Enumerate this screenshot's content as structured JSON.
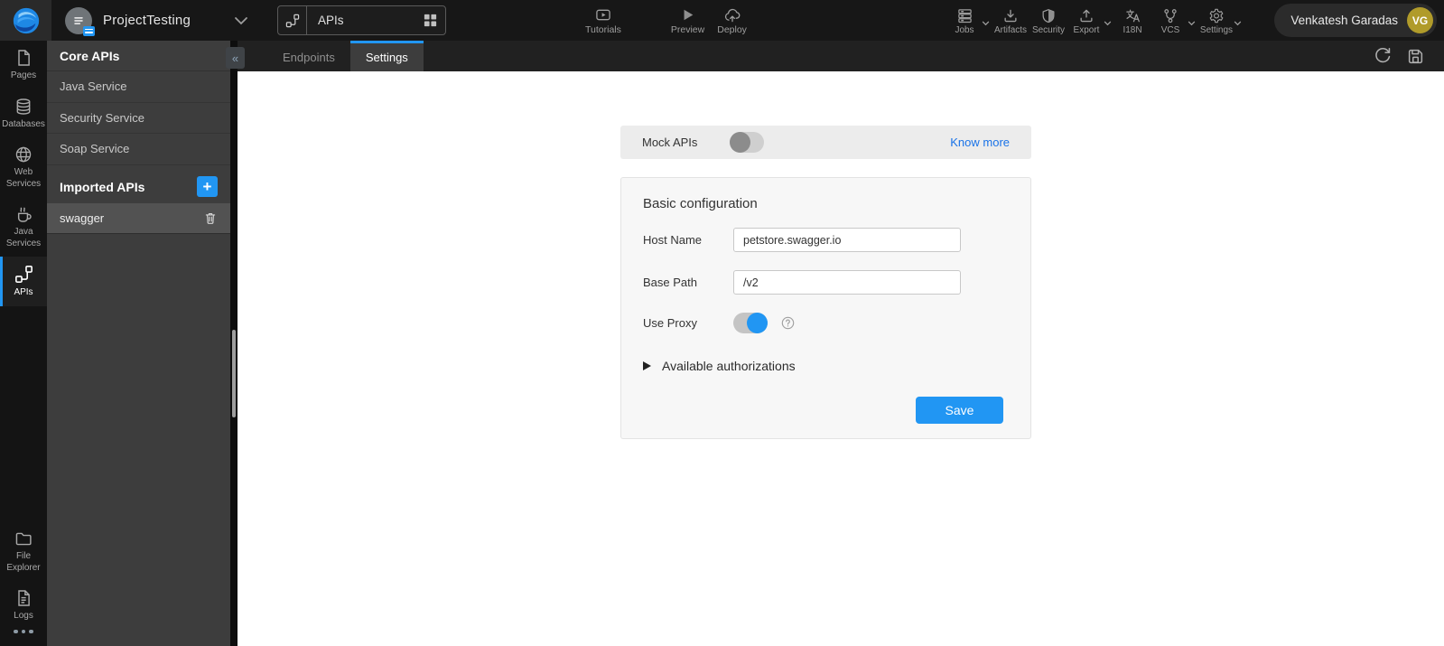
{
  "colors": {
    "accent": "#2196f3",
    "link": "#1a73e8",
    "avatar": "#b09b2a"
  },
  "header": {
    "project_name": "ProjectTesting",
    "workspace_selector": {
      "label": "APIs"
    },
    "center_actions": [
      {
        "label": "Tutorials",
        "icon": "tutorials-icon"
      },
      {
        "label": "Preview",
        "icon": "preview-icon"
      },
      {
        "label": "Deploy",
        "icon": "deploy-icon"
      }
    ],
    "right_actions": [
      {
        "label": "Jobs",
        "icon": "jobs-icon",
        "has_chevron": true
      },
      {
        "label": "Artifacts",
        "icon": "artifacts-icon",
        "has_chevron": false
      },
      {
        "label": "Security",
        "icon": "security-icon",
        "has_chevron": false
      },
      {
        "label": "Export",
        "icon": "export-icon",
        "has_chevron": true
      },
      {
        "label": "I18N",
        "icon": "i18n-icon",
        "has_chevron": false
      },
      {
        "label": "VCS",
        "icon": "vcs-icon",
        "has_chevron": true
      },
      {
        "label": "Settings",
        "icon": "settings-icon",
        "has_chevron": true
      }
    ],
    "user": {
      "name": "Venkatesh Garadas",
      "initials": "VG"
    }
  },
  "sidebar": {
    "items": [
      {
        "label": "Pages",
        "icon": "pages-icon",
        "active": false
      },
      {
        "label": "Databases",
        "icon": "databases-icon",
        "active": false
      },
      {
        "label": "Web Services",
        "icon": "web-services-icon",
        "active": false
      },
      {
        "label": "Java Services",
        "icon": "java-services-icon",
        "active": false
      },
      {
        "label": "APIs",
        "icon": "apis-icon",
        "active": true
      },
      {
        "label": "File Explorer",
        "icon": "file-explorer-icon",
        "active": false
      },
      {
        "label": "Logs",
        "icon": "logs-icon",
        "active": false
      }
    ]
  },
  "panel": {
    "core_header": "Core APIs",
    "collapse_glyph": "«",
    "core_items": [
      {
        "label": "Java Service"
      },
      {
        "label": "Security Service"
      },
      {
        "label": "Soap Service"
      }
    ],
    "imported_header": "Imported APIs",
    "add_glyph": "+",
    "imported_items": [
      {
        "label": "swagger",
        "selected": true
      }
    ]
  },
  "tabs": [
    {
      "label": "Endpoints",
      "active": false
    },
    {
      "label": "Settings",
      "active": true
    }
  ],
  "settings_page": {
    "mock_apis_label": "Mock APIs",
    "mock_apis_on": false,
    "know_more_label": "Know more",
    "section_title": "Basic configuration",
    "fields": [
      {
        "label": "Host Name",
        "value": "petstore.swagger.io"
      },
      {
        "label": "Base Path",
        "value": "/v2"
      }
    ],
    "use_proxy_label": "Use Proxy",
    "use_proxy_on": true,
    "authorizations_label": "Available authorizations",
    "save_label": "Save"
  }
}
